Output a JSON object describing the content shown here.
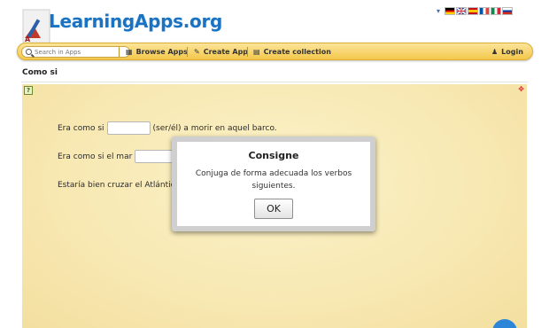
{
  "header": {
    "logo_text": "LearningApps.org",
    "languages": [
      "de",
      "en",
      "es",
      "fr",
      "it",
      "ru"
    ],
    "language_caret": "▾"
  },
  "toolbar": {
    "search_placeholder": "Search in Apps",
    "browse_label": "Browse Apps",
    "create_label": "Create App",
    "collection_label": "Create collection",
    "login_label": "Login"
  },
  "page": {
    "title": "Como si"
  },
  "exercise": {
    "line1_before": "Era como si",
    "line1_after": "(ser/él) a morir en aquel barco.",
    "line2_before": "Era como si el mar",
    "line3_before": "Estaría bien cruzar el Atlántic"
  },
  "modal": {
    "title": "Consigne",
    "text": "Conjuga de forma adecuada los verbos siguientes.",
    "ok_label": "OK"
  },
  "colors": {
    "toolbar": "#f4c84b",
    "logo": "#1a73c2",
    "app_background": "#f8e9b4",
    "fab": "#2e86d8"
  }
}
